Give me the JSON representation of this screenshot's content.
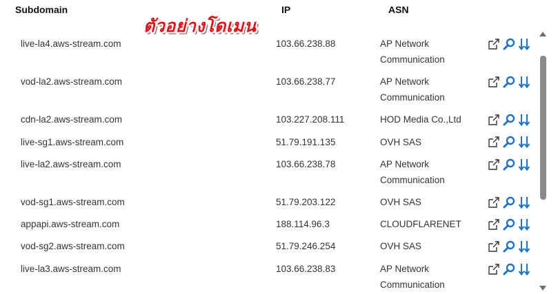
{
  "headers": {
    "subdomain": "Subdomain",
    "ip": "IP",
    "asn": "ASN"
  },
  "overlay_text": "ตัวอย่างโดเมน",
  "rows": [
    {
      "subdomain": "live-la4.aws-stream.com",
      "ip": "103.66.238.88",
      "asn": "AP Network Communication"
    },
    {
      "subdomain": "vod-la2.aws-stream.com",
      "ip": "103.66.238.77",
      "asn": "AP Network Communication"
    },
    {
      "subdomain": "cdn-la2.aws-stream.com",
      "ip": "103.227.208.111",
      "asn": "HOD Media Co.,Ltd"
    },
    {
      "subdomain": "live-sg1.aws-stream.com",
      "ip": "51.79.191.135",
      "asn": "OVH SAS"
    },
    {
      "subdomain": "live-la2.aws-stream.com",
      "ip": "103.66.238.78",
      "asn": "AP Network Communication"
    },
    {
      "subdomain": "vod-sg1.aws-stream.com",
      "ip": "51.79.203.122",
      "asn": "OVH SAS"
    },
    {
      "subdomain": "appapi.aws-stream.com",
      "ip": "188.114.96.3",
      "asn": "CLOUDFLARENET"
    },
    {
      "subdomain": "vod-sg2.aws-stream.com",
      "ip": "51.79.246.254",
      "asn": "OVH SAS"
    },
    {
      "subdomain": "live-la3.aws-stream.com",
      "ip": "103.66.238.83",
      "asn": "AP Network Communication"
    }
  ],
  "icons": {
    "open": "external-link-icon",
    "search": "search-icon",
    "sort": "sort-down-icon"
  },
  "colors": {
    "icon_blue": "#1a73c9",
    "overlay_red": "#d9161b"
  }
}
